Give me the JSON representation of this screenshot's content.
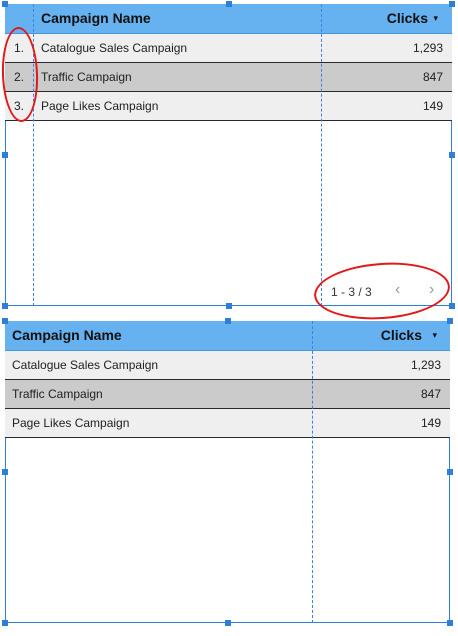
{
  "table1": {
    "headers": {
      "name": "Campaign Name",
      "clicks": "Clicks",
      "sort_icon": "▾"
    },
    "rows": [
      {
        "num": "1.",
        "name": "Catalogue Sales Campaign",
        "clicks": "1,293"
      },
      {
        "num": "2.",
        "name": "Traffic Campaign",
        "clicks": "847"
      },
      {
        "num": "3.",
        "name": "Page Likes Campaign",
        "clicks": "149"
      }
    ],
    "pagination": {
      "label": "1 - 3 / 3",
      "prev_icon": "‹",
      "next_icon": "›"
    }
  },
  "table2": {
    "headers": {
      "name": "Campaign Name",
      "clicks": "Clicks",
      "sort_icon": "▾"
    },
    "rows": [
      {
        "name": "Catalogue Sales Campaign",
        "clicks": "1,293"
      },
      {
        "name": "Traffic Campaign",
        "clicks": "847"
      },
      {
        "name": "Page Likes Campaign",
        "clicks": "149"
      }
    ]
  },
  "colors": {
    "header_bg": "#66b1ef",
    "selection_frame": "#2f7fd9",
    "row_light": "#efefef",
    "row_dark": "#cbcbcb",
    "annotation_red": "#e01919"
  }
}
